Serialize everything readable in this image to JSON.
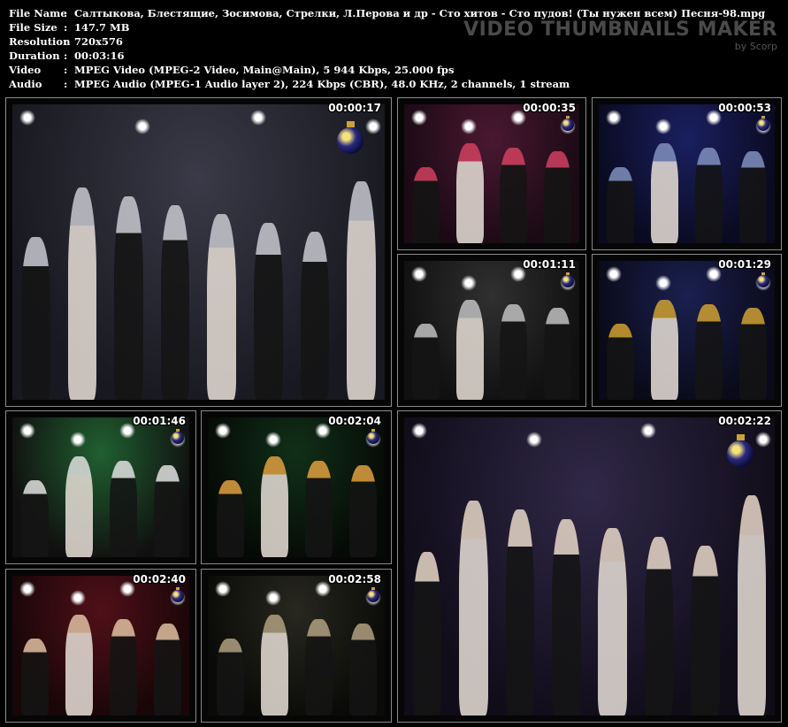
{
  "info": {
    "rows": [
      {
        "key": "File Name",
        "value": "Салтыкова, Блестящие, Зосимова, Стрелки, Л.Перова и др - Сто хитов - Сто пудов! (Ты нужен всем) Песня-98.mpg"
      },
      {
        "key": "File Size",
        "value": "147.7 MB"
      },
      {
        "key": "Resolution",
        "value": "720x576"
      },
      {
        "key": "Duration",
        "value": "00:03:16"
      },
      {
        "key": "Video",
        "value": "MPEG Video (MPEG-2 Video, Main@Main), 5 944 Kbps, 25.000 fps"
      },
      {
        "key": "Audio",
        "value": "MPEG Audio (MPEG-1 Audio layer 2), 224 Kbps (CBR), 48.0 KHz, 2 channels, 1 stream"
      }
    ],
    "separator": ":"
  },
  "brand": {
    "title": "VIDEO THUMBNAILS MAKER",
    "subtitle": "by Scorp"
  },
  "thumbnails": [
    {
      "time": "00:00:17",
      "scene": "stage-band",
      "colors": [
        "#3a3a48",
        "#c8c8d0",
        "#181820"
      ]
    },
    {
      "time": "00:00:35",
      "scene": "singers-closeup",
      "colors": [
        "#4a1830",
        "#d04060",
        "#1a0a14"
      ]
    },
    {
      "time": "00:00:53",
      "scene": "stage-wide",
      "colors": [
        "#1a2060",
        "#8090c0",
        "#0a0a20"
      ]
    },
    {
      "time": "00:01:11",
      "scene": "dancer-jacket",
      "colors": [
        "#303030",
        "#c0c0c0",
        "#101010"
      ]
    },
    {
      "time": "00:01:29",
      "scene": "group-stage",
      "colors": [
        "#1a2050",
        "#d0a030",
        "#0a0a18"
      ]
    },
    {
      "time": "00:01:46",
      "scene": "duo-singers",
      "colors": [
        "#206030",
        "#e0e0e0",
        "#101010"
      ]
    },
    {
      "time": "00:02:04",
      "scene": "singer-closeup",
      "colors": [
        "#103018",
        "#e0a040",
        "#060a06"
      ]
    },
    {
      "time": "00:02:22",
      "scene": "group-finale",
      "colors": [
        "#302848",
        "#e8d8c8",
        "#100c18"
      ]
    },
    {
      "time": "00:02:40",
      "scene": "drummer",
      "colors": [
        "#501018",
        "#e0c0a0",
        "#180608"
      ]
    },
    {
      "time": "00:02:58",
      "scene": "crowd-stage",
      "colors": [
        "#282820",
        "#b0a080",
        "#0a0a08"
      ]
    }
  ]
}
